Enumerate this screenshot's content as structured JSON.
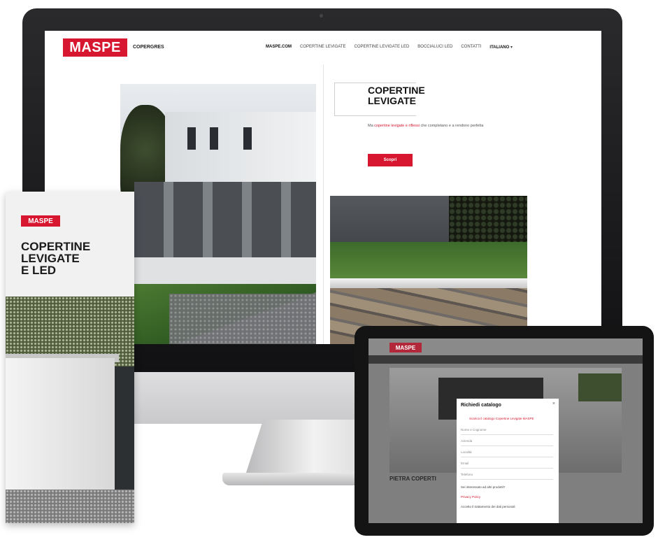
{
  "colors": {
    "brand_red": "#d7172f",
    "bezel": "#1a1a1c"
  },
  "monitor": {
    "logo": "MASPE",
    "logo_sub": "COPERGRES",
    "nav": [
      "MASPE.COM",
      "COPERTINE LEVIGATE",
      "COPERTINE LEVIGATE LED",
      "BOCCIALUCI LED",
      "CONTATTI",
      "ITALIANO"
    ],
    "nav_caret": "▾",
    "title_line1": "COPERTINE",
    "title_line2": "LEVIGATE",
    "desc_pre": "Ma ",
    "desc_link": "copertine levigate e riflessi",
    "desc_post": " che completano e a rendono perfetta",
    "cta": "Scopri"
  },
  "brochure": {
    "logo": "MASPE",
    "title_line1": "COPERTINE",
    "title_line2": "LEVIGATE",
    "title_line3": "E LED"
  },
  "tablet": {
    "logo": "MASPE",
    "caption": "PIETRA COPERTI",
    "modal": {
      "title": "Richiedi catalogo",
      "close": "×",
      "link": "Scarica il catalogo Copertine Levigate MASPE",
      "fields": [
        "Nome e Cognome",
        "Azienda",
        "Località",
        "Email",
        "Telefono"
      ],
      "question": "Sei interessato ad altri prodotti?",
      "privacy": "Privacy Policy",
      "consent": "Accetto il trattamento dei dati personali"
    }
  }
}
